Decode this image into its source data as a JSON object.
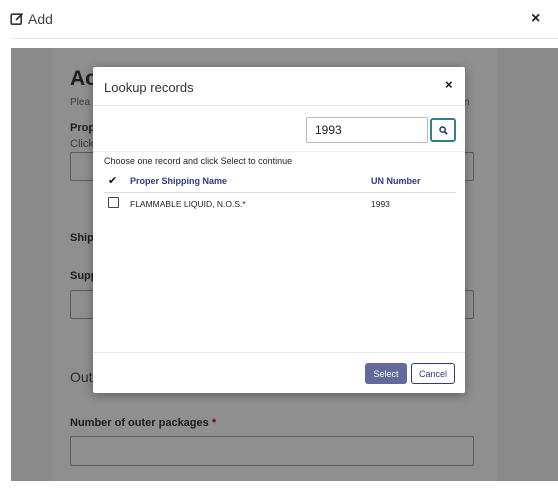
{
  "window": {
    "title": "Add"
  },
  "background": {
    "heading": "Ac",
    "hint": "Plea",
    "hint_right": "n",
    "field1_label": "Propr",
    "field1_sub": "Click",
    "shipping_label": "Ship",
    "supp_label": "Supp",
    "outer_section": "Out",
    "outer_packages_label": "Number of outer packages",
    "required_mark": "*"
  },
  "modal": {
    "title": "Lookup records",
    "search_value": "1993",
    "instruction": "Choose one record and click Select to continue",
    "columns": {
      "name": "Proper Shipping Name",
      "un": "UN Number"
    },
    "rows": [
      {
        "name": "FLAMMABLE LIQUID, N.O.S.*",
        "un": "1993"
      }
    ],
    "select_label": "Select",
    "cancel_label": "Cancel"
  },
  "icons": {
    "edit": "edit-square-icon",
    "close": "close-icon",
    "search": "search-icon",
    "check": "checkmark-icon"
  },
  "colors": {
    "accent": "#2d3b87",
    "select_button": "#616a9b",
    "search_border": "#2f7f8c",
    "overlay": "#8a8a8a"
  }
}
